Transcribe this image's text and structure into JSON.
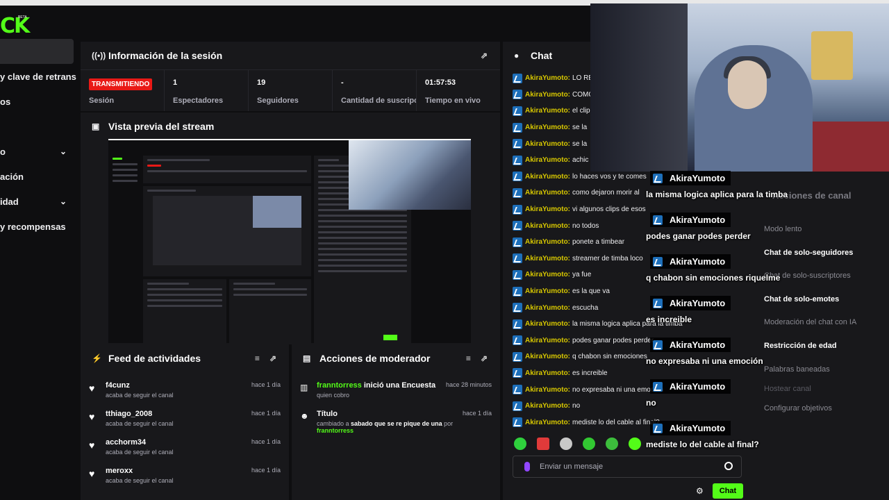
{
  "logo": {
    "text": "CK",
    "beta": "BETA"
  },
  "sidebar": {
    "items": [
      {
        "label": "",
        "active": true,
        "chevron": false
      },
      {
        "label": "y clave de retransmisión",
        "chevron": false
      },
      {
        "label": "os",
        "chevron": false
      },
      {
        "label": "",
        "chevron": false
      },
      {
        "label": "o",
        "chevron": true
      },
      {
        "label": "ación",
        "chevron": false
      },
      {
        "label": "idad",
        "chevron": true
      },
      {
        "label": "y recompensas",
        "chevron": false
      }
    ]
  },
  "session": {
    "title": "Información de la sesión",
    "badge": "TRANSMITIENDO",
    "badge_label": "Sesión",
    "stats": [
      {
        "value": "1",
        "label": "Espectadores"
      },
      {
        "value": "19",
        "label": "Seguidores"
      },
      {
        "value": "-",
        "label": "Cantidad de suscripciones"
      },
      {
        "value": "01:57:53",
        "label": "Tiempo en vivo"
      }
    ]
  },
  "preview": {
    "title": "Vista previa del stream"
  },
  "feed": {
    "title": "Feed de actividades",
    "items": [
      {
        "name": "f4cunz",
        "sub": "acaba de seguir el canal",
        "time": "hace 1 día"
      },
      {
        "name": "tthiago_2008",
        "sub": "acaba de seguir el canal",
        "time": "hace 1 día"
      },
      {
        "name": "acchorm34",
        "sub": "acaba de seguir el canal",
        "time": "hace 1 día"
      },
      {
        "name": "meroxx",
        "sub": "acaba de seguir el canal",
        "time": "hace 1 día"
      }
    ]
  },
  "mod_actions": {
    "title": "Acciones de moderador",
    "items": [
      {
        "user": "franntorress",
        "action": "inició una Encuesta",
        "sub": "quien cobro",
        "time": "hace 28 minutos"
      },
      {
        "user": "Título",
        "action": "",
        "sub_prefix": "cambiado a",
        "sub_bold": "sabado que se re pique de una",
        "sub_by": "por",
        "sub_user": "franntorress",
        "time": "hace 1 día"
      }
    ]
  },
  "chat": {
    "title": "Chat",
    "messages": [
      {
        "user": "AkiraYumoto:",
        "text": "LO RE"
      },
      {
        "user": "AkiraYumoto:",
        "text": "COMO"
      },
      {
        "user": "AkiraYumoto:",
        "text": "el clip"
      },
      {
        "user": "AkiraYumoto:",
        "text": "se la"
      },
      {
        "user": "AkiraYumoto:",
        "text": "se la"
      },
      {
        "user": "AkiraYumoto:",
        "text": "achic"
      },
      {
        "user": "AkiraYumoto:",
        "text": "lo haces vos y te comes"
      },
      {
        "user": "AkiraYumoto:",
        "text": "como dejaron morir al"
      },
      {
        "user": "AkiraYumoto:",
        "text": "vi algunos clips de esos"
      },
      {
        "user": "AkiraYumoto:",
        "text": "no todos"
      },
      {
        "user": "AkiraYumoto:",
        "text": "ponete a timbear"
      },
      {
        "user": "AkiraYumoto:",
        "text": "streamer de timba loco"
      },
      {
        "user": "AkiraYumoto:",
        "text": "ya fue"
      },
      {
        "user": "AkiraYumoto:",
        "text": "es la que va"
      },
      {
        "user": "AkiraYumoto:",
        "text": "escucha"
      },
      {
        "user": "AkiraYumoto:",
        "text": "la misma logica aplica para la timba"
      },
      {
        "user": "AkiraYumoto:",
        "text": "podes ganar podes perder"
      },
      {
        "user": "AkiraYumoto:",
        "text": "q chabon sin emociones"
      },
      {
        "user": "AkiraYumoto:",
        "text": "es increible"
      },
      {
        "user": "AkiraYumoto:",
        "text": "no expresaba ni una emoción"
      },
      {
        "user": "AkiraYumoto:",
        "text": "no"
      },
      {
        "user": "AkiraYumoto:",
        "text": "mediste lo del cable al final?"
      }
    ],
    "input_placeholder": "Enviar un mensaje",
    "send_label": "Chat"
  },
  "overlay": {
    "messages": [
      {
        "user": "AkiraYumoto",
        "text": "la misma logica aplica para la timba"
      },
      {
        "user": "AkiraYumoto",
        "text": "podes ganar podes perder"
      },
      {
        "user": "AkiraYumoto",
        "text": "q chabon sin emociones riquelme"
      },
      {
        "user": "AkiraYumoto",
        "text": "es increible"
      },
      {
        "user": "AkiraYumoto",
        "text": "no expresaba ni una emoción"
      },
      {
        "user": "AkiraYumoto",
        "text": "no"
      },
      {
        "user": "AkiraYumoto",
        "text": "mediste lo del cable al final?"
      }
    ]
  },
  "mod_menu": {
    "title": "Acciones de canal",
    "items": [
      {
        "label": "Modo lento",
        "enabled": false
      },
      {
        "label": "Chat de solo-seguidores",
        "enabled": true
      },
      {
        "label": "Chat de solo-suscriptores",
        "enabled": false
      },
      {
        "label": "Chat de solo-emotes",
        "enabled": true
      },
      {
        "label": "Moderación del chat con IA",
        "enabled": false
      },
      {
        "label": "Restricción de edad",
        "enabled": true
      },
      {
        "label": "Palabras baneadas",
        "enabled": false
      },
      {
        "label": "Hostear canal",
        "enabled": false
      },
      {
        "label": "Configurar objetivos",
        "enabled": false
      }
    ]
  },
  "colors": {
    "accent": "#53fc18",
    "live": "#e91916",
    "username": "#d8c800",
    "panel": "#18181b",
    "background": "#0e0e10"
  }
}
